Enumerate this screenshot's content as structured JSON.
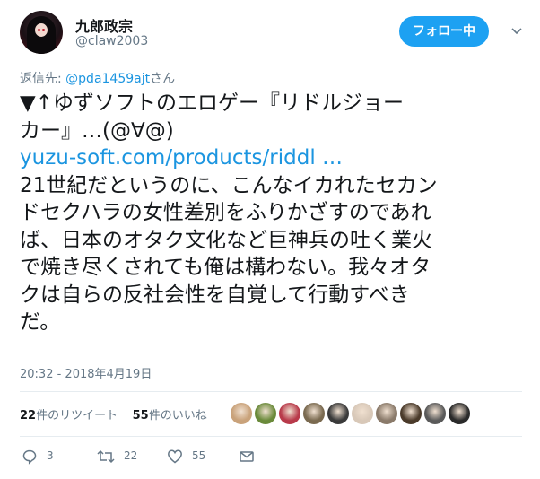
{
  "user": {
    "name": "九郎政宗",
    "handle": "@claw2003",
    "follow_label": "フォロー中"
  },
  "reply": {
    "prefix": "返信先: ",
    "to": "@pda1459ajt",
    "suffix": "さん"
  },
  "tweet": {
    "line1": "▼↑ゆずソフトのエロゲー『リドルジョー",
    "line2": "カー』…(@∀@)",
    "link": "yuzu-soft.com/products/riddl …",
    "line3": "21世紀だというのに、こんなイカれたセカン",
    "line4": "ドセクハラの女性差別をふりかざすのであれ",
    "line5": "ば、日本のオタク文化など巨神兵の吐く業火",
    "line6": "で焼き尽くされても俺は構わない。我々オタ",
    "line7": "クは自らの反社会性を自覚して行動すべき",
    "line8": "だ。"
  },
  "timestamp": "20:32 - 2018年4月19日",
  "stats": {
    "retweets_count": "22",
    "retweets_label": "件のリツイート",
    "likes_count": "55",
    "likes_label": "件のいいね"
  },
  "likers": [
    {
      "color": "#c9a27a",
      "icon": "avatar"
    },
    {
      "color": "#6a8a3a",
      "icon": "avatar"
    },
    {
      "color": "#b83a4a",
      "icon": "avatar"
    },
    {
      "color": "#7a6a50",
      "icon": "avatar"
    },
    {
      "color": "#3a3a3a",
      "icon": "avatar"
    },
    {
      "color": "#d8c8b8",
      "icon": "avatar"
    },
    {
      "color": "#8a7a6a",
      "icon": "avatar"
    },
    {
      "color": "#4a3a2a",
      "icon": "avatar"
    },
    {
      "color": "#5a5a5a",
      "icon": "avatar"
    },
    {
      "color": "#2a2a2a",
      "icon": "avatar"
    }
  ],
  "actions": {
    "reply_count": "3",
    "retweet_count": "22",
    "like_count": "55"
  },
  "colors": {
    "accent": "#1da1f2",
    "link": "#1b95e0",
    "muted": "#657786"
  }
}
